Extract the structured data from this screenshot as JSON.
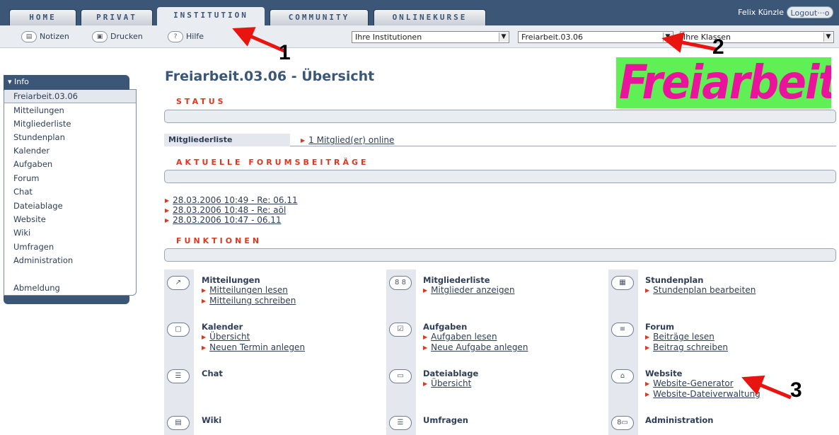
{
  "tabs": [
    "HOME",
    "PRIVAT",
    "INSTITUTION",
    "COMMUNITY",
    "ONLINEKURSE"
  ],
  "user": {
    "name": "Felix Künzle",
    "logout": "Logout"
  },
  "toolbar": {
    "notes": "Notizen",
    "print": "Drucken",
    "help": "Hilfe"
  },
  "selects": {
    "institutions": "Ihre Institutionen",
    "group": "Freiarbeit.03.06",
    "classes": "Ihre Klassen"
  },
  "sidebar": {
    "header": "Info",
    "active": "Freiarbeit.03.06",
    "items": [
      "Mitteilungen",
      "Mitgliederliste",
      "Stundenplan",
      "Kalender",
      "Aufgaben",
      "Forum",
      "Chat",
      "Dateiablage",
      "Website",
      "Wiki",
      "Umfragen",
      "Administration"
    ],
    "logout": "Abmeldung"
  },
  "main": {
    "title": "Freiarbeit.03.06 - Übersicht",
    "logo_text": "Freiarbeit",
    "status_label": "STATUS",
    "members_label": "Mitgliederliste",
    "members_online": "1 Mitglied(er) online",
    "forum_label": "AKTUELLE FORUMSBEITRÄGE",
    "forum_posts": [
      "28.03.2006 10:49 - Re: 06.11",
      "28.03.2006 10:48 - Re: aöl",
      "28.03.2006 10:47 - 06.11"
    ],
    "functions_label": "FUNKTIONEN"
  },
  "functions": [
    {
      "title": "Mitteilungen",
      "icon": "message-icon",
      "links": [
        "Mitteilungen lesen",
        "Mitteilung schreiben"
      ]
    },
    {
      "title": "Mitgliederliste",
      "icon": "members-icon",
      "links": [
        "Mitglieder anzeigen"
      ]
    },
    {
      "title": "Stundenplan",
      "icon": "timetable-icon",
      "links": [
        "Stundenplan bearbeiten"
      ]
    },
    {
      "title": "Kalender",
      "icon": "calendar-icon",
      "links": [
        "Übersicht",
        "Neuen Termin anlegen"
      ]
    },
    {
      "title": "Aufgaben",
      "icon": "checkbox-icon",
      "links": [
        "Aufgaben lesen",
        "Neue Aufgabe anlegen"
      ]
    },
    {
      "title": "Forum",
      "icon": "forum-icon",
      "links": [
        "Beiträge lesen",
        "Beitrag schreiben"
      ]
    },
    {
      "title": "Chat",
      "icon": "chat-icon",
      "links": []
    },
    {
      "title": "Dateiablage",
      "icon": "folder-icon",
      "links": [
        "Übersicht"
      ]
    },
    {
      "title": "Website",
      "icon": "house-icon",
      "links": [
        "Website-Generator",
        "Website-Dateiverwaltung"
      ]
    },
    {
      "title": "Wiki",
      "icon": "wiki-icon",
      "links": []
    },
    {
      "title": "Umfragen",
      "icon": "survey-icon",
      "links": []
    },
    {
      "title": "Administration",
      "icon": "admin-icon",
      "links": []
    }
  ],
  "annotations": [
    "1",
    "2",
    "3"
  ],
  "colors": {
    "nav": "#3b5677",
    "accent": "#e0361c",
    "logo_bg": "#60ef55",
    "logo_text": "#e9149b"
  }
}
